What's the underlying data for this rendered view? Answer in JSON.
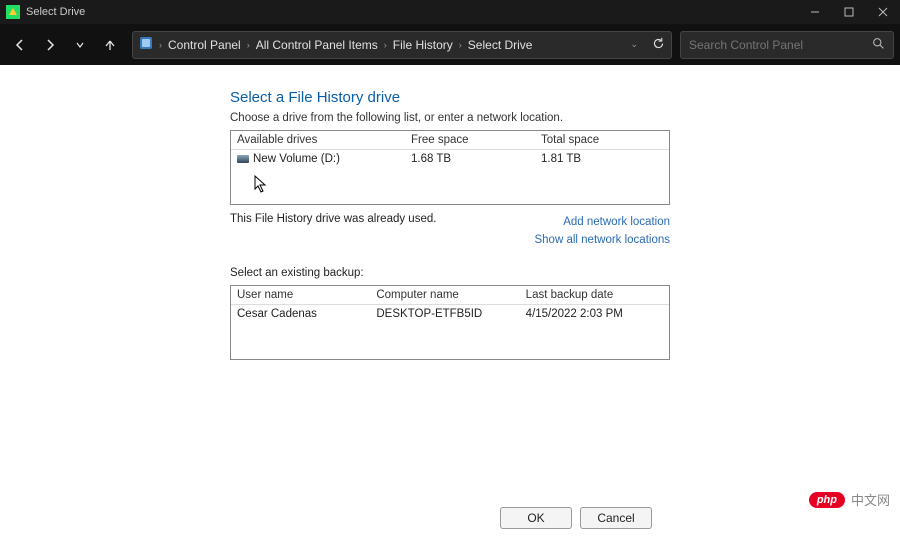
{
  "titlebar": {
    "title": "Select Drive"
  },
  "nav": {
    "crumbs": [
      "Control Panel",
      "All Control Panel Items",
      "File History",
      "Select Drive"
    ],
    "search_placeholder": "Search Control Panel"
  },
  "page": {
    "title": "Select a File History drive",
    "instruction": "Choose a drive from the following list, or enter a network location."
  },
  "drives": {
    "headers": {
      "c1": "Available drives",
      "c2": "Free space",
      "c3": "Total space"
    },
    "rows": [
      {
        "name": "New Volume (D:)",
        "free": "1.68 TB",
        "total": "1.81 TB"
      }
    ]
  },
  "status": {
    "text": "This File History drive was already used.",
    "add_loc": "Add network location",
    "show_all": "Show all network locations"
  },
  "existing": {
    "label": "Select an existing backup:",
    "headers": {
      "b1": "User name",
      "b2": "Computer name",
      "b3": "Last backup date"
    },
    "rows": [
      {
        "user": "Cesar Cadenas",
        "computer": "DESKTOP-ETFB5ID",
        "date": "4/15/2022 2:03 PM"
      }
    ]
  },
  "buttons": {
    "ok": "OK",
    "cancel": "Cancel"
  },
  "watermark": {
    "logo": "php",
    "text": "中文网"
  }
}
